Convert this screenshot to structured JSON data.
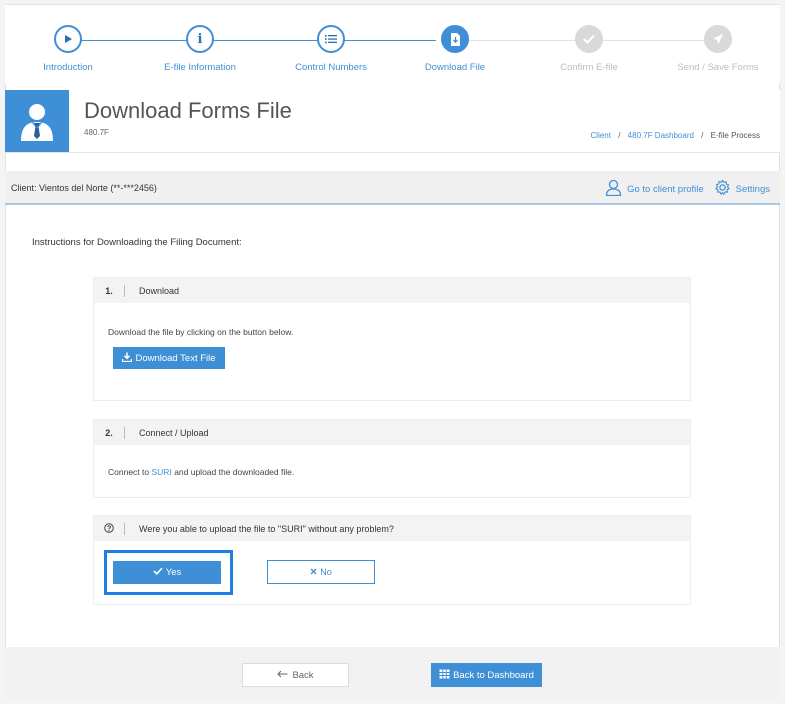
{
  "stepper": {
    "steps": [
      {
        "label": "Introduction",
        "icon": "play-icon",
        "state": "done"
      },
      {
        "label": "E-file Information",
        "icon": "info-icon",
        "state": "done"
      },
      {
        "label": "Control Numbers",
        "icon": "list-icon",
        "state": "done"
      },
      {
        "label": "Download File",
        "icon": "download-file-icon",
        "state": "active"
      },
      {
        "label": "Confirm E-file",
        "icon": "check-icon",
        "state": "future"
      },
      {
        "label": "Send / Save Forms",
        "icon": "send-icon",
        "state": "future"
      }
    ]
  },
  "header": {
    "title": "Download Forms File",
    "subtitle": "480.7F",
    "breadcrumb": {
      "client": "Client",
      "dashboard": "480.7F Dashboard",
      "current": "E-file Process",
      "sep": "/"
    }
  },
  "client_bar": {
    "label_prefix": "Client:",
    "client_name": "Vientos del Norte (**-***2456)",
    "profile_link": "Go to client profile",
    "settings_link": "Settings"
  },
  "main": {
    "instructions": "Instructions for Downloading the Filing Document:",
    "step1": {
      "number": "1.",
      "title": "Download",
      "text": "Download the file by clicking on the button below.",
      "button": "Download Text File"
    },
    "step2": {
      "number": "2.",
      "title": "Connect / Upload",
      "text_before": "Connect to",
      "link": "SURI",
      "text_after": "and upload the downloaded file."
    },
    "question": {
      "icon": "question-circle-icon",
      "text": "Were you able to upload the file to \"SURI\" without any problem?",
      "yes": "Yes",
      "no": "No"
    }
  },
  "footer": {
    "back": "Back",
    "dashboard": "Back to Dashboard"
  },
  "colors": {
    "accent": "#3f8fd6",
    "highlight": "#1e7fe0",
    "inactive": "#d9d9d9"
  }
}
